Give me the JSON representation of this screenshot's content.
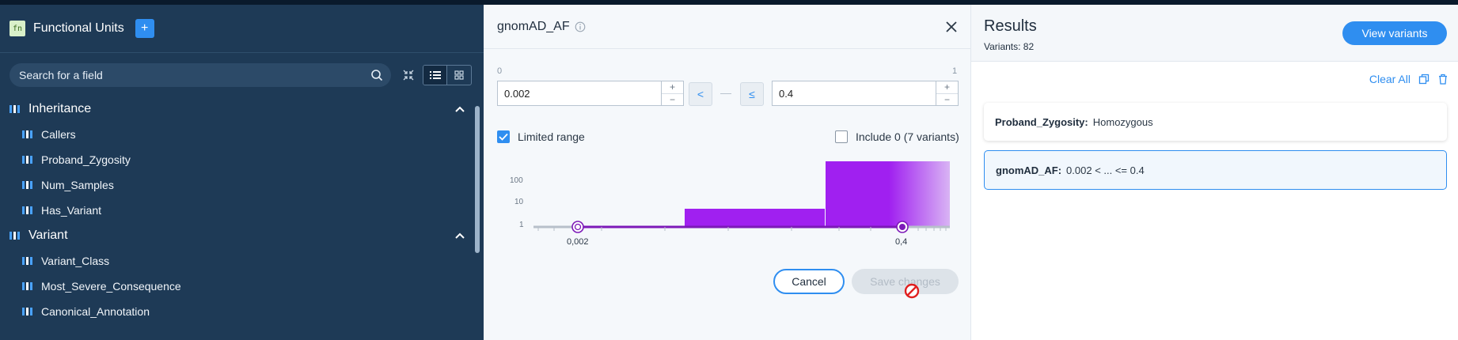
{
  "left_panel": {
    "icon_text": "fn",
    "title": "Functional Units",
    "add_label": "+",
    "search_placeholder": "Search for a field",
    "categories": [
      {
        "label": "Inheritance",
        "fields": [
          "Callers",
          "Proband_Zygosity",
          "Num_Samples",
          "Has_Variant"
        ]
      },
      {
        "label": "Variant",
        "fields": [
          "Variant_Class",
          "Most_Severe_Consequence",
          "Canonical_Annotation"
        ]
      }
    ]
  },
  "filter_panel": {
    "title": "gnomAD_AF",
    "min_label": "0",
    "max_label": "1",
    "lower_value": "0.002",
    "upper_value": "0.4",
    "lower_op": "<",
    "upper_op": "≤",
    "step_up": "+",
    "step_down": "−",
    "limited_range_label": "Limited range",
    "limited_range_checked": true,
    "include_zero_label": "Include 0 (7 variants)",
    "include_zero_checked": false,
    "histogram": {
      "y_ticks": [
        "100",
        "10",
        "1"
      ],
      "lower_marker_label": "0,002",
      "upper_marker_label": "0,4",
      "bar_color": "#a020f0"
    },
    "cancel_label": "Cancel",
    "save_label": "Save changes"
  },
  "results_panel": {
    "title": "Results",
    "variants_text": "Variants: 82",
    "view_button": "View variants",
    "clear_all": "Clear All",
    "filters": [
      {
        "name": "Proband_Zygosity:",
        "value": "Homozygous"
      },
      {
        "name": "gnomAD_AF:",
        "value": "0.002 < ... <= 0.4"
      }
    ]
  },
  "colors": {
    "accent": "#2f8ef0",
    "sidebar_bg": "#1e3a56",
    "histogram": "#a020f0"
  }
}
